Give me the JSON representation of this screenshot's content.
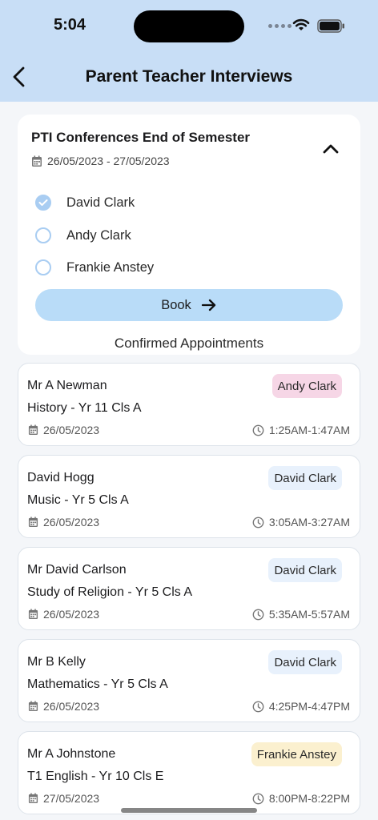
{
  "status_bar": {
    "time": "5:04"
  },
  "header": {
    "title": "Parent Teacher Interviews"
  },
  "event": {
    "title": "PTI Conferences End of Semester",
    "date_range": "26/05/2023 - 27/05/2023",
    "children": [
      {
        "name": "David Clark",
        "selected": true
      },
      {
        "name": "Andy Clark",
        "selected": false
      },
      {
        "name": "Frankie Anstey",
        "selected": false
      }
    ],
    "book_label": "Book"
  },
  "appointments_heading": "Confirmed Appointments",
  "appointments": [
    {
      "teacher": "Mr A Newman",
      "subject": "History - Yr 11 Cls A",
      "date": "26/05/2023",
      "time": "1:25AM-1:47AM",
      "child": "Andy Clark",
      "badge_color": "#f6d6e6"
    },
    {
      "teacher": "David Hogg",
      "subject": "Music - Yr 5 Cls A",
      "date": "26/05/2023",
      "time": "3:05AM-3:27AM",
      "child": "David Clark",
      "badge_color": "#e8f1fc"
    },
    {
      "teacher": "Mr David Carlson",
      "subject": "Study of Religion - Yr 5 Cls A",
      "date": "26/05/2023",
      "time": "5:35AM-5:57AM",
      "child": "David Clark",
      "badge_color": "#e8f1fc"
    },
    {
      "teacher": "Mr B Kelly",
      "subject": "Mathematics - Yr 5 Cls A",
      "date": "26/05/2023",
      "time": "4:25PM-4:47PM",
      "child": "David Clark",
      "badge_color": "#e8f1fc"
    },
    {
      "teacher": "Mr A Johnstone",
      "subject": "T1 English - Yr 10 Cls E",
      "date": "27/05/2023",
      "time": "8:00PM-8:22PM",
      "child": "Frankie Anstey",
      "badge_color": "#fbf0cf"
    }
  ],
  "colors": {
    "header_bg": "#c8def6",
    "accent": "#a9cdf2",
    "button_bg": "#b9dcf8"
  }
}
